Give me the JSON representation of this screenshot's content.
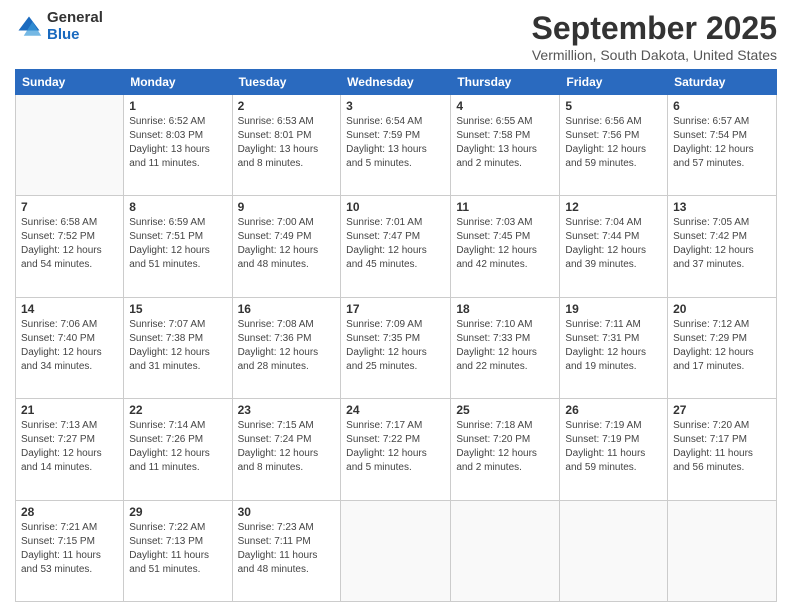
{
  "logo": {
    "general": "General",
    "blue": "Blue"
  },
  "title": "September 2025",
  "location": "Vermillion, South Dakota, United States",
  "days_of_week": [
    "Sunday",
    "Monday",
    "Tuesday",
    "Wednesday",
    "Thursday",
    "Friday",
    "Saturday"
  ],
  "weeks": [
    [
      {
        "day": "",
        "info": ""
      },
      {
        "day": "1",
        "info": "Sunrise: 6:52 AM\nSunset: 8:03 PM\nDaylight: 13 hours\nand 11 minutes."
      },
      {
        "day": "2",
        "info": "Sunrise: 6:53 AM\nSunset: 8:01 PM\nDaylight: 13 hours\nand 8 minutes."
      },
      {
        "day": "3",
        "info": "Sunrise: 6:54 AM\nSunset: 7:59 PM\nDaylight: 13 hours\nand 5 minutes."
      },
      {
        "day": "4",
        "info": "Sunrise: 6:55 AM\nSunset: 7:58 PM\nDaylight: 13 hours\nand 2 minutes."
      },
      {
        "day": "5",
        "info": "Sunrise: 6:56 AM\nSunset: 7:56 PM\nDaylight: 12 hours\nand 59 minutes."
      },
      {
        "day": "6",
        "info": "Sunrise: 6:57 AM\nSunset: 7:54 PM\nDaylight: 12 hours\nand 57 minutes."
      }
    ],
    [
      {
        "day": "7",
        "info": "Sunrise: 6:58 AM\nSunset: 7:52 PM\nDaylight: 12 hours\nand 54 minutes."
      },
      {
        "day": "8",
        "info": "Sunrise: 6:59 AM\nSunset: 7:51 PM\nDaylight: 12 hours\nand 51 minutes."
      },
      {
        "day": "9",
        "info": "Sunrise: 7:00 AM\nSunset: 7:49 PM\nDaylight: 12 hours\nand 48 minutes."
      },
      {
        "day": "10",
        "info": "Sunrise: 7:01 AM\nSunset: 7:47 PM\nDaylight: 12 hours\nand 45 minutes."
      },
      {
        "day": "11",
        "info": "Sunrise: 7:03 AM\nSunset: 7:45 PM\nDaylight: 12 hours\nand 42 minutes."
      },
      {
        "day": "12",
        "info": "Sunrise: 7:04 AM\nSunset: 7:44 PM\nDaylight: 12 hours\nand 39 minutes."
      },
      {
        "day": "13",
        "info": "Sunrise: 7:05 AM\nSunset: 7:42 PM\nDaylight: 12 hours\nand 37 minutes."
      }
    ],
    [
      {
        "day": "14",
        "info": "Sunrise: 7:06 AM\nSunset: 7:40 PM\nDaylight: 12 hours\nand 34 minutes."
      },
      {
        "day": "15",
        "info": "Sunrise: 7:07 AM\nSunset: 7:38 PM\nDaylight: 12 hours\nand 31 minutes."
      },
      {
        "day": "16",
        "info": "Sunrise: 7:08 AM\nSunset: 7:36 PM\nDaylight: 12 hours\nand 28 minutes."
      },
      {
        "day": "17",
        "info": "Sunrise: 7:09 AM\nSunset: 7:35 PM\nDaylight: 12 hours\nand 25 minutes."
      },
      {
        "day": "18",
        "info": "Sunrise: 7:10 AM\nSunset: 7:33 PM\nDaylight: 12 hours\nand 22 minutes."
      },
      {
        "day": "19",
        "info": "Sunrise: 7:11 AM\nSunset: 7:31 PM\nDaylight: 12 hours\nand 19 minutes."
      },
      {
        "day": "20",
        "info": "Sunrise: 7:12 AM\nSunset: 7:29 PM\nDaylight: 12 hours\nand 17 minutes."
      }
    ],
    [
      {
        "day": "21",
        "info": "Sunrise: 7:13 AM\nSunset: 7:27 PM\nDaylight: 12 hours\nand 14 minutes."
      },
      {
        "day": "22",
        "info": "Sunrise: 7:14 AM\nSunset: 7:26 PM\nDaylight: 12 hours\nand 11 minutes."
      },
      {
        "day": "23",
        "info": "Sunrise: 7:15 AM\nSunset: 7:24 PM\nDaylight: 12 hours\nand 8 minutes."
      },
      {
        "day": "24",
        "info": "Sunrise: 7:17 AM\nSunset: 7:22 PM\nDaylight: 12 hours\nand 5 minutes."
      },
      {
        "day": "25",
        "info": "Sunrise: 7:18 AM\nSunset: 7:20 PM\nDaylight: 12 hours\nand 2 minutes."
      },
      {
        "day": "26",
        "info": "Sunrise: 7:19 AM\nSunset: 7:19 PM\nDaylight: 11 hours\nand 59 minutes."
      },
      {
        "day": "27",
        "info": "Sunrise: 7:20 AM\nSunset: 7:17 PM\nDaylight: 11 hours\nand 56 minutes."
      }
    ],
    [
      {
        "day": "28",
        "info": "Sunrise: 7:21 AM\nSunset: 7:15 PM\nDaylight: 11 hours\nand 53 minutes."
      },
      {
        "day": "29",
        "info": "Sunrise: 7:22 AM\nSunset: 7:13 PM\nDaylight: 11 hours\nand 51 minutes."
      },
      {
        "day": "30",
        "info": "Sunrise: 7:23 AM\nSunset: 7:11 PM\nDaylight: 11 hours\nand 48 minutes."
      },
      {
        "day": "",
        "info": ""
      },
      {
        "day": "",
        "info": ""
      },
      {
        "day": "",
        "info": ""
      },
      {
        "day": "",
        "info": ""
      }
    ]
  ]
}
